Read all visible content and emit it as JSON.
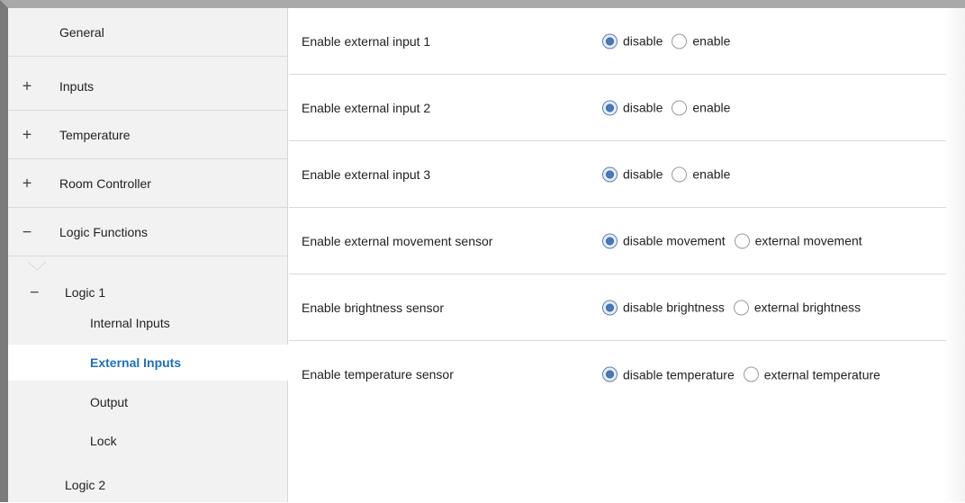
{
  "sidebar": {
    "items": [
      {
        "sign": "",
        "label": "General"
      },
      {
        "sign": "+",
        "label": "Inputs"
      },
      {
        "sign": "+",
        "label": "Temperature"
      },
      {
        "sign": "+",
        "label": "Room Controller"
      },
      {
        "sign": "−",
        "label": "Logic Functions"
      }
    ],
    "logic1": {
      "sign": "−",
      "label": "Logic 1"
    },
    "subitems": [
      {
        "label": "Internal Inputs"
      },
      {
        "label": "External Inputs"
      },
      {
        "label": "Output"
      },
      {
        "label": "Lock"
      }
    ],
    "logic2": {
      "label": "Logic 2"
    }
  },
  "params": [
    {
      "label": "Enable external input 1",
      "options": [
        "disable",
        "enable"
      ],
      "selected": "disable"
    },
    {
      "label": "Enable external input 2",
      "options": [
        "disable",
        "enable"
      ],
      "selected": "disable"
    },
    {
      "label": "Enable external input 3",
      "options": [
        "disable",
        "enable"
      ],
      "selected": "disable"
    },
    {
      "label": "Enable external movement sensor",
      "options": [
        "disable movement",
        "external movement"
      ],
      "selected": "disable movement"
    },
    {
      "label": "Enable brightness sensor",
      "options": [
        "disable brightness",
        "external brightness"
      ],
      "selected": "disable brightness"
    },
    {
      "label": "Enable temperature sensor",
      "options": [
        "disable temperature",
        "external temperature"
      ],
      "selected": "disable temperature"
    }
  ],
  "colors": {
    "accent": "#1f6fbf",
    "radio_checked": "#4a78bd",
    "sidebar_bg": "#f2f2f2"
  }
}
